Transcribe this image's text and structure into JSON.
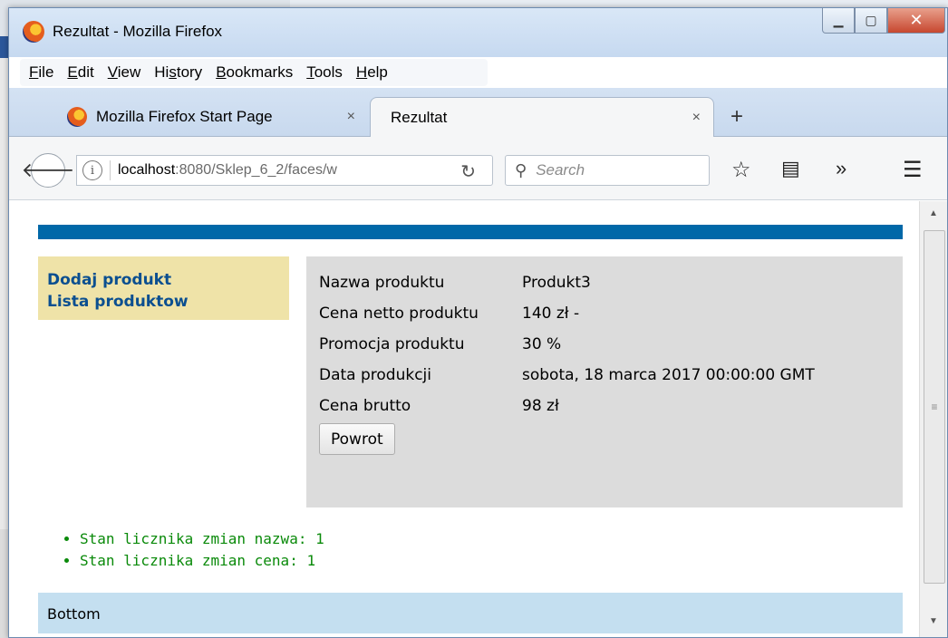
{
  "window": {
    "title": "Rezultat - Mozilla Firefox"
  },
  "menu": {
    "items": [
      {
        "label_prefix": "",
        "accel": "F",
        "label_suffix": "ile"
      },
      {
        "label_prefix": "",
        "accel": "E",
        "label_suffix": "dit"
      },
      {
        "label_prefix": "",
        "accel": "V",
        "label_suffix": "iew"
      },
      {
        "label_prefix": "Hi",
        "accel": "s",
        "label_suffix": "tory"
      },
      {
        "label_prefix": "",
        "accel": "B",
        "label_suffix": "ookmarks"
      },
      {
        "label_prefix": "",
        "accel": "T",
        "label_suffix": "ools"
      },
      {
        "label_prefix": "",
        "accel": "H",
        "label_suffix": "elp"
      }
    ]
  },
  "tabs": [
    {
      "label": "Mozilla Firefox Start Page",
      "close": "×"
    },
    {
      "label": "Rezultat",
      "close": "×"
    }
  ],
  "newtab_label": "+",
  "navbar": {
    "url_host": "localhost",
    "url_rest": ":8080/Sklep_6_2/faces/w",
    "search_placeholder": "Search"
  },
  "page": {
    "nav": [
      "Dodaj produkt",
      "Lista produktow"
    ],
    "rows": [
      {
        "label": "Nazwa produktu",
        "value": "Produkt3"
      },
      {
        "label": "Cena netto produktu",
        "value": "140 zł -"
      },
      {
        "label": "Promocja produktu",
        "value": "30 %"
      },
      {
        "label": "Data produkcji",
        "value": "sobota, 18 marca 2017 00:00:00 GMT"
      },
      {
        "label": "Cena brutto",
        "value": "98 zł"
      }
    ],
    "back_button": "Powrot",
    "counters": [
      "Stan licznika zmian nazwa: 1",
      "Stan licznika zmian cena: 1"
    ],
    "footer": "Bottom"
  }
}
